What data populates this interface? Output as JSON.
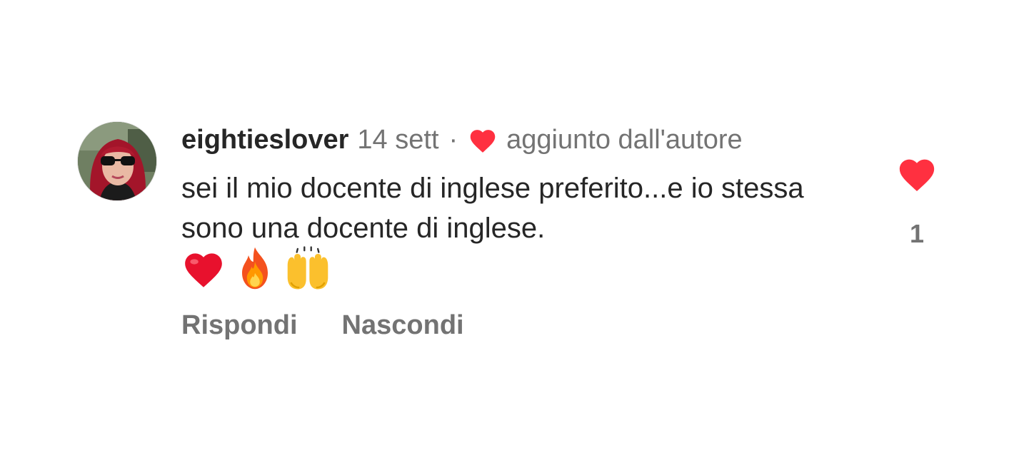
{
  "comment": {
    "username": "eightieslover",
    "timestamp": "14 sett",
    "separator": "·",
    "author_liked_label": "aggiunto dall'autore",
    "text": "sei il mio docente di inglese preferito...e io stessa sono una docente di inglese.",
    "emojis": [
      "red-heart-emoji",
      "fire-emoji",
      "raising-hands-emoji"
    ],
    "actions": {
      "reply_label": "Rispondi",
      "hide_label": "Nascondi"
    },
    "like_count": "1"
  },
  "colors": {
    "like_red": "#ff3040",
    "text_primary": "#262626",
    "text_secondary": "#737373"
  }
}
